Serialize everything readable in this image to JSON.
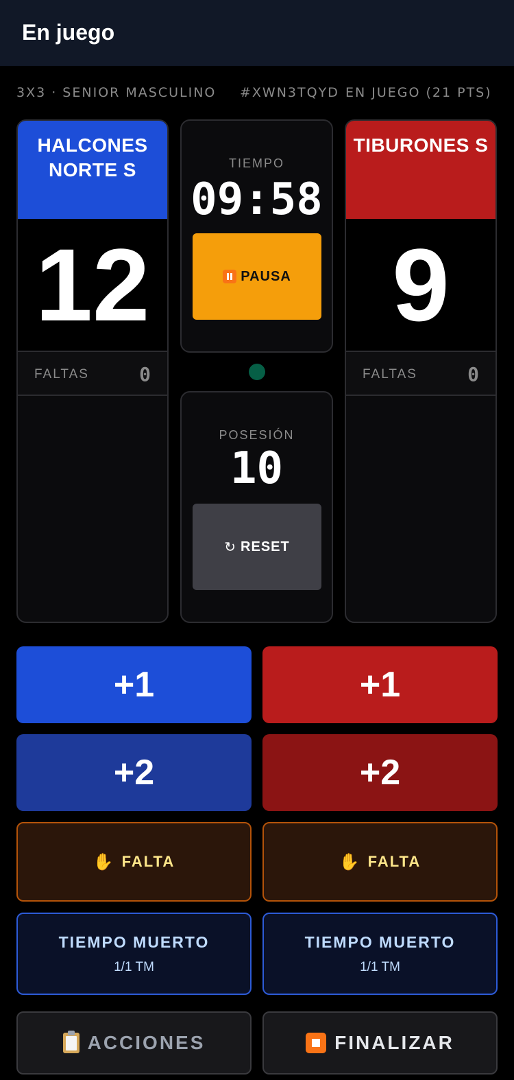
{
  "header": {
    "title": "En juego"
  },
  "meta": {
    "category": "3X3 · SENIOR MASCULINO",
    "code": "#XWN3TQYD",
    "status": "EN JUEGO (21 PTS)"
  },
  "teams": [
    {
      "name": "HALCONES NORTE S",
      "score": "12",
      "fouls_label": "FALTAS",
      "fouls": "0",
      "color": "#1d4ed8"
    },
    {
      "name": "TIBURONES S",
      "score": "9",
      "fouls_label": "FALTAS",
      "fouls": "0",
      "color": "#b91c1c"
    }
  ],
  "timer": {
    "label": "TIEMPO",
    "value": "09:58",
    "pause_label": "PAUSA",
    "pause_icon": "pause-icon"
  },
  "possession": {
    "label": "POSESIÓN",
    "value": "10",
    "reset_glyph": "↻",
    "reset_label": "RESET"
  },
  "actions": {
    "plus1": "+1",
    "plus2": "+2",
    "foul_icon": "✋",
    "foul_label": "FALTA",
    "timeout_label": "TIEMPO MUERTO",
    "timeout_count": "1/1 TM",
    "acciones_label": "ACCIONES",
    "finalizar_label": "FINALIZAR"
  },
  "colors": {
    "accent_pause": "#f59e0b",
    "status_dot": "#065f46",
    "foul_border": "#b45309",
    "timeout_border": "#2d5bd7"
  }
}
